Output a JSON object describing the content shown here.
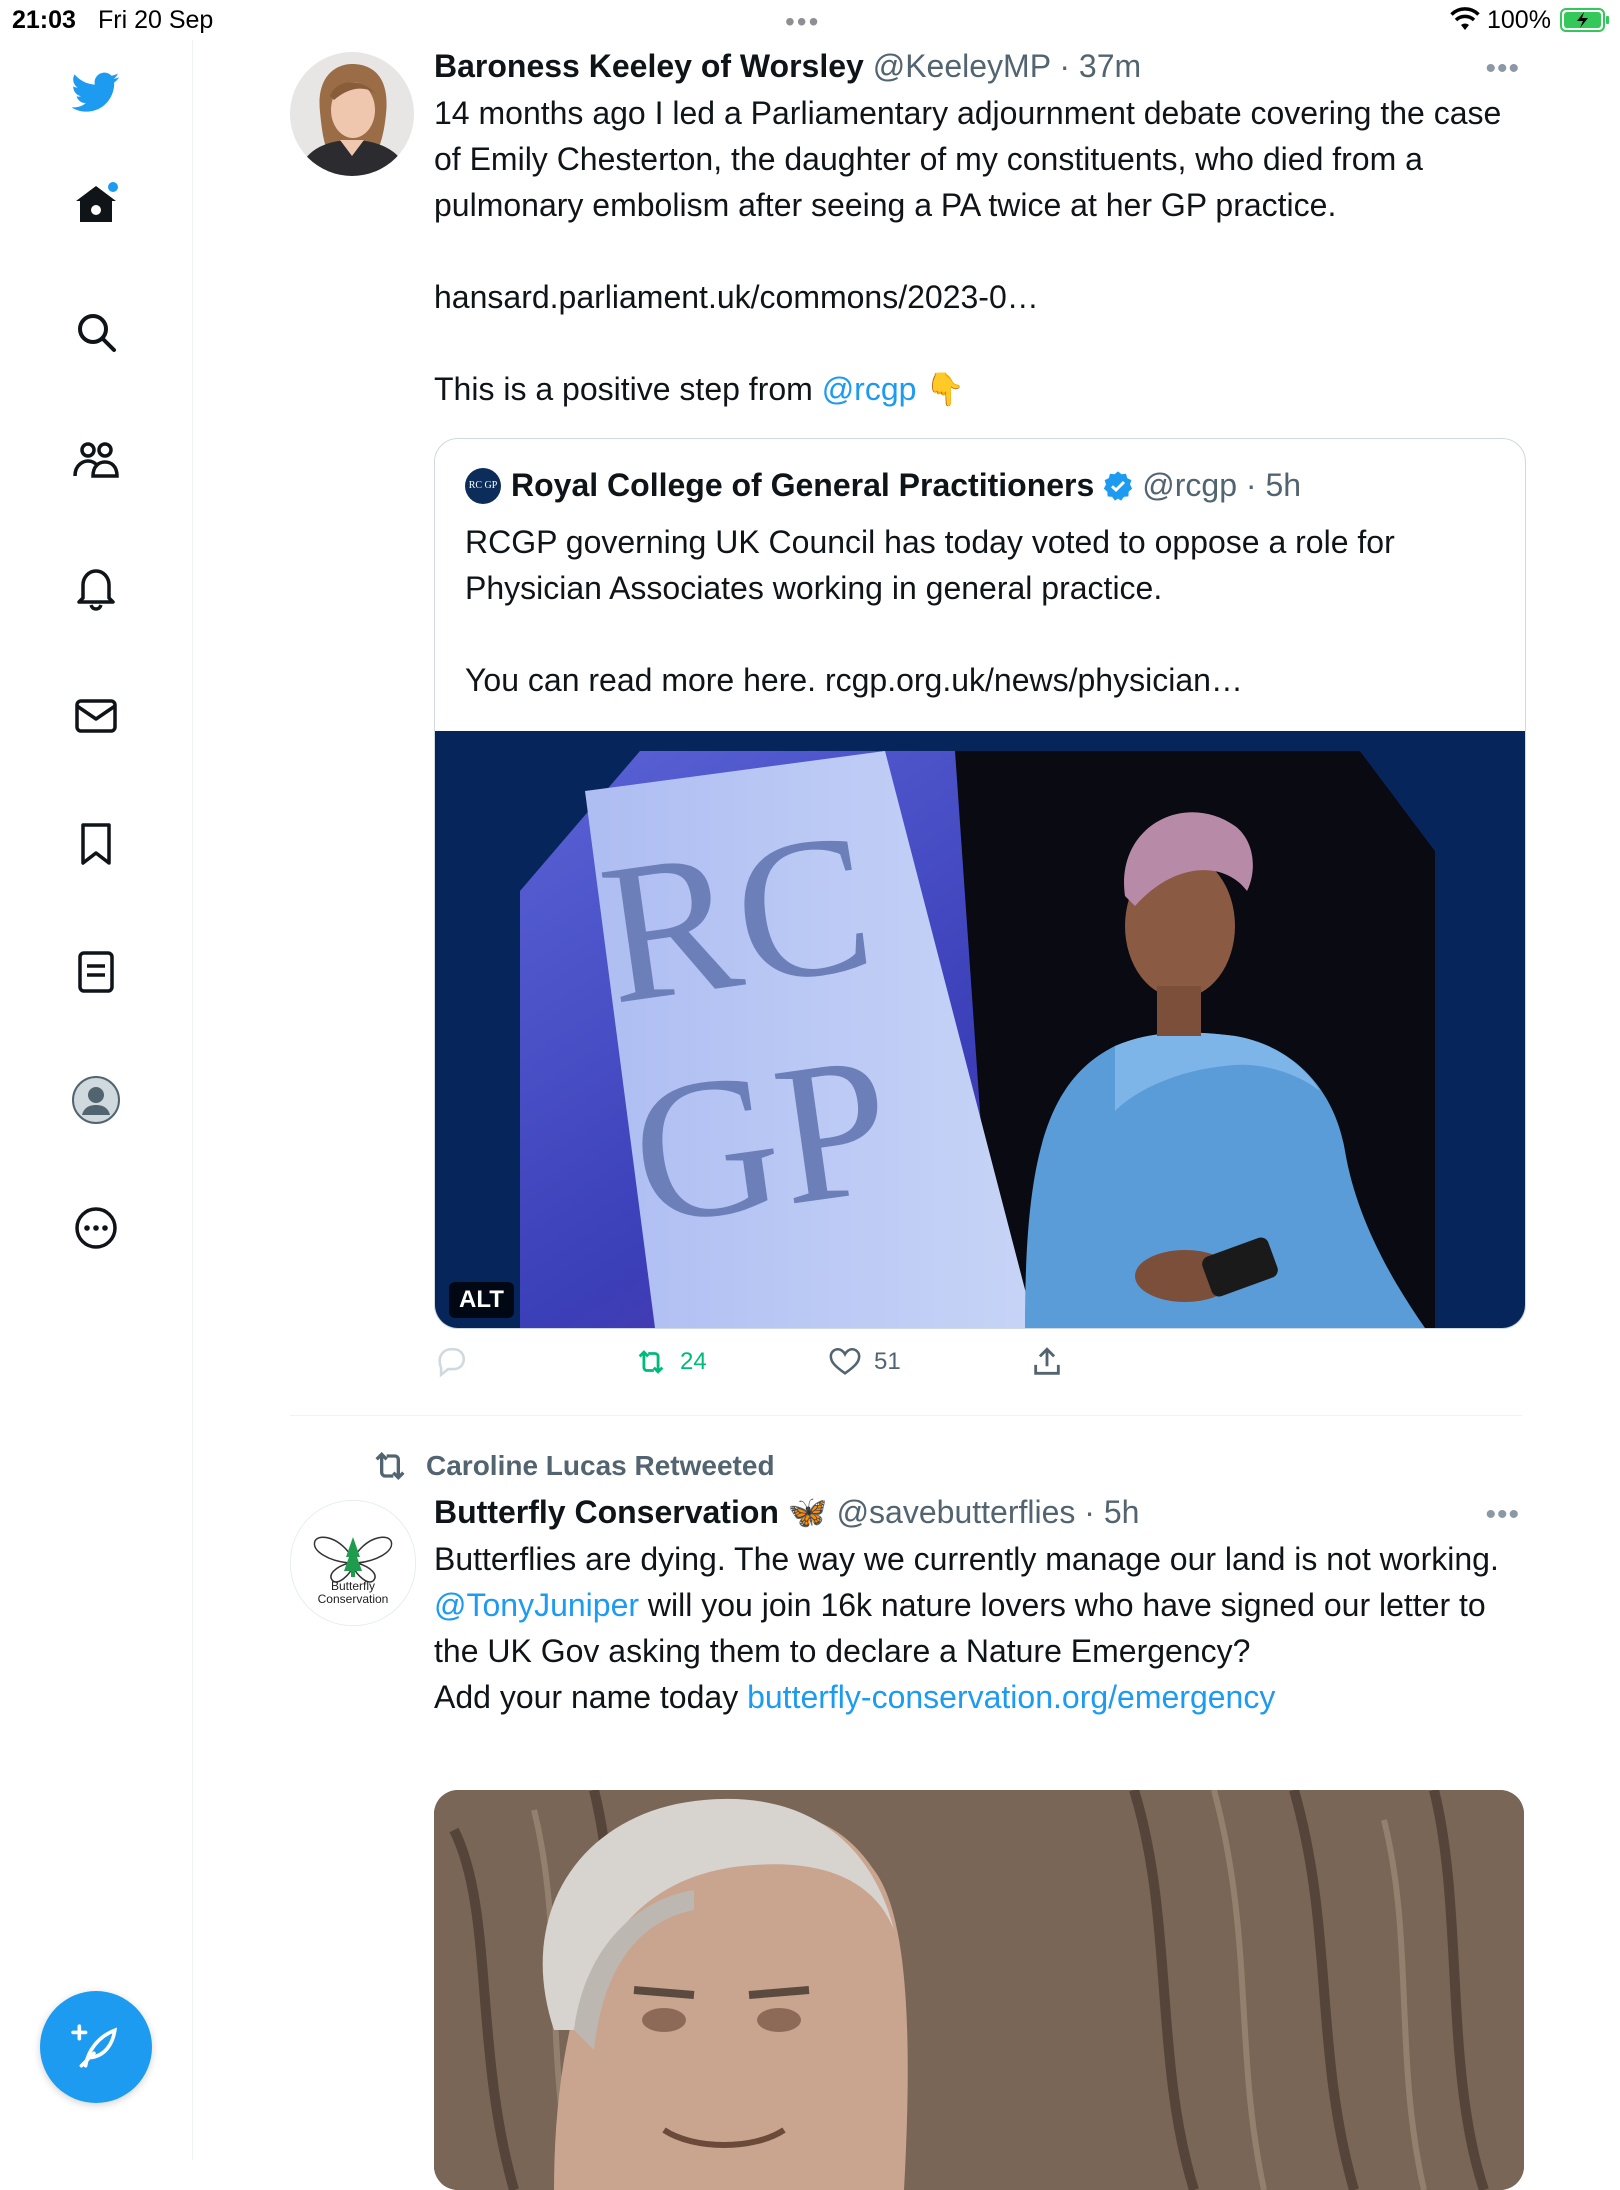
{
  "status_bar": {
    "time": "21:03",
    "date": "Fri 20 Sep",
    "battery": "100%"
  },
  "tweets": [
    {
      "name": "Baroness Keeley of Worsley",
      "handle": "@KeeleyMP",
      "time": "37m",
      "text_1": "14 months ago I led a Parliamentary adjournment debate covering the case of Emily Chesterton, the daughter of my constituents, who died from a pulmonary embolism after seeing a PA twice at her GP practice.",
      "link": "hansard.parliament.uk/commons/2023-0…",
      "text_2_prefix": "This is a positive step from ",
      "mention": "@rcgp",
      "emoji": "👇",
      "quote": {
        "logo_text": "RC GP",
        "name": "Royal College of General Practitioners",
        "handle": "@rcgp",
        "time": "5h",
        "text_1": "RCGP governing UK Council has today voted to oppose a role for Physician Associates working in general practice.",
        "text_2_prefix": "You can read more here. ",
        "text_2_link": "rcgp.org.uk/news/physician…",
        "image_sign_1": "RC",
        "image_sign_2": "GP",
        "alt_badge": "ALT"
      },
      "actions": {
        "retweets": "24",
        "likes": "51"
      }
    },
    {
      "retweeted_by": "Caroline Lucas Retweeted",
      "avatar_label": "Butterfly Conservation",
      "name": "Butterfly Conservation",
      "emoji": "🦋",
      "handle": "@savebutterflies",
      "time": "5h",
      "text_1": "Butterflies are dying. The way we currently manage our land is not working.",
      "mention": "@TonyJuniper",
      "text_2": " will you join 16k nature lovers who have signed our letter to the UK Gov asking them to declare a Nature Emergency?",
      "text_3_prefix": "Add your name today ",
      "link": "butterfly-conservation.org/emergency"
    }
  ],
  "colors": {
    "accent": "#1d9bf0",
    "retweet_green": "#00ba7c",
    "text": "#0f1419",
    "secondary": "#536471"
  },
  "icons": [
    "twitter-bird-icon",
    "home-icon",
    "search-icon",
    "communities-icon",
    "notifications-icon",
    "messages-icon",
    "bookmarks-icon",
    "lists-icon",
    "profile-icon",
    "more-icon",
    "compose-icon"
  ]
}
